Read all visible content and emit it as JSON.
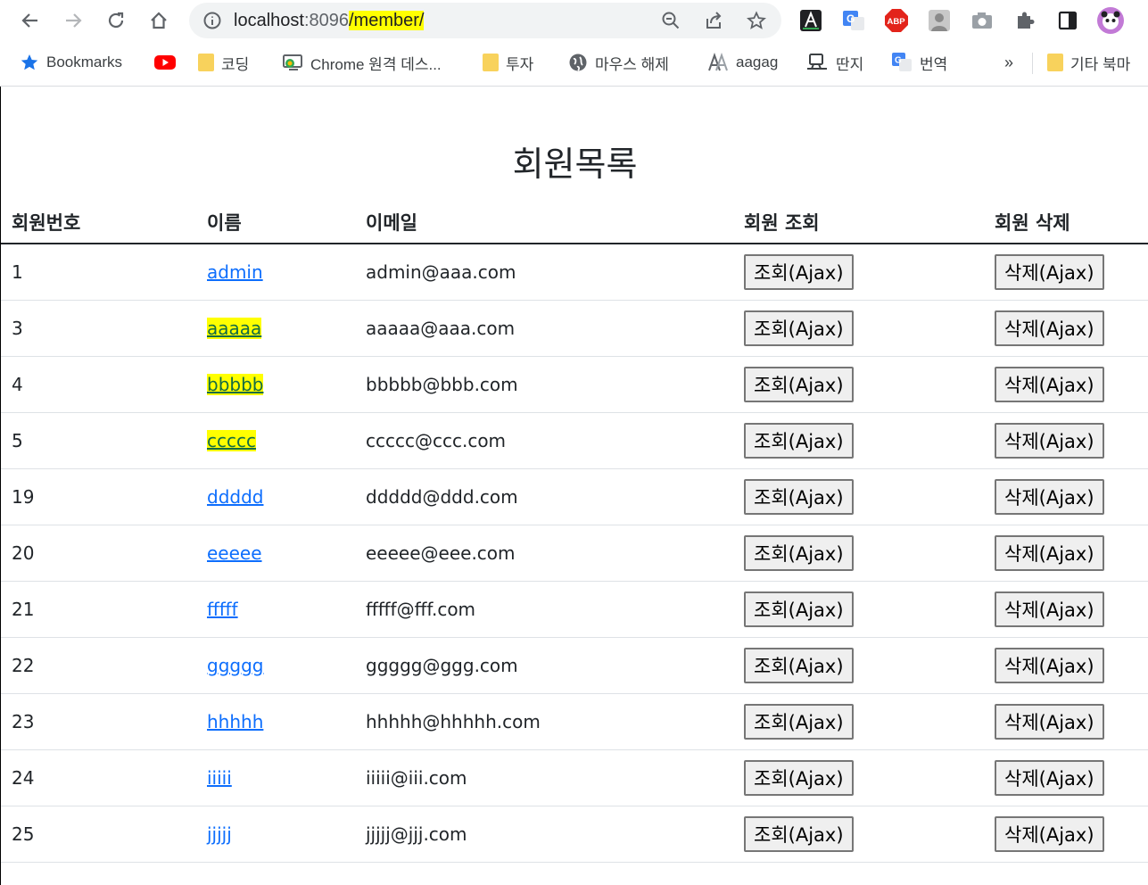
{
  "browser": {
    "url_host": "localhost",
    "url_port": ":8096",
    "url_path": "/member/",
    "bookmarks": [
      {
        "label": "Bookmarks",
        "icon": "star-icon"
      },
      {
        "label": "",
        "icon": "youtube-icon"
      },
      {
        "label": "코딩",
        "icon": "folder-icon"
      },
      {
        "label": "Chrome 원격 데스...",
        "icon": "remote-desktop-icon"
      },
      {
        "label": "투자",
        "icon": "folder-icon"
      },
      {
        "label": "마우스 해제",
        "icon": "globe-icon"
      },
      {
        "label": "aagag",
        "icon": "aagag-icon"
      },
      {
        "label": "딴지",
        "icon": "ddanzi-icon"
      },
      {
        "label": "번역",
        "icon": "translate-icon"
      }
    ],
    "overflow": "»",
    "other_bookmarks": "기타 북마"
  },
  "page": {
    "title": "회원목록",
    "headers": [
      "회원번호",
      "이름",
      "이메일",
      "회원 조회",
      "회원 삭제"
    ],
    "view_button": "조회(Ajax)",
    "delete_button": "삭제(Ajax)",
    "rows": [
      {
        "id": "1",
        "name": "admin",
        "email": "admin@aaa.com",
        "highlight": false
      },
      {
        "id": "3",
        "name": "aaaaa",
        "email": "aaaaa@aaa.com",
        "highlight": true
      },
      {
        "id": "4",
        "name": "bbbbb",
        "email": "bbbbb@bbb.com",
        "highlight": true
      },
      {
        "id": "5",
        "name": "ccccc",
        "email": "ccccc@ccc.com",
        "highlight": true
      },
      {
        "id": "19",
        "name": "ddddd",
        "email": "ddddd@ddd.com",
        "highlight": false
      },
      {
        "id": "20",
        "name": "eeeee",
        "email": "eeeee@eee.com",
        "highlight": false
      },
      {
        "id": "21",
        "name": "fffff",
        "email": "fffff@fff.com",
        "highlight": false
      },
      {
        "id": "22",
        "name": "ggggg",
        "email": "ggggg@ggg.com",
        "highlight": false
      },
      {
        "id": "23",
        "name": "hhhhh",
        "email": "hhhhh@hhhhh.com",
        "highlight": false
      },
      {
        "id": "24",
        "name": "iiiii",
        "email": "iiiii@iii.com",
        "highlight": false
      },
      {
        "id": "25",
        "name": "jjjjj",
        "email": "jjjjj@jjj.com",
        "highlight": false
      }
    ]
  },
  "colors": {
    "link": "#0d6efd",
    "highlight": "#ffff00"
  }
}
